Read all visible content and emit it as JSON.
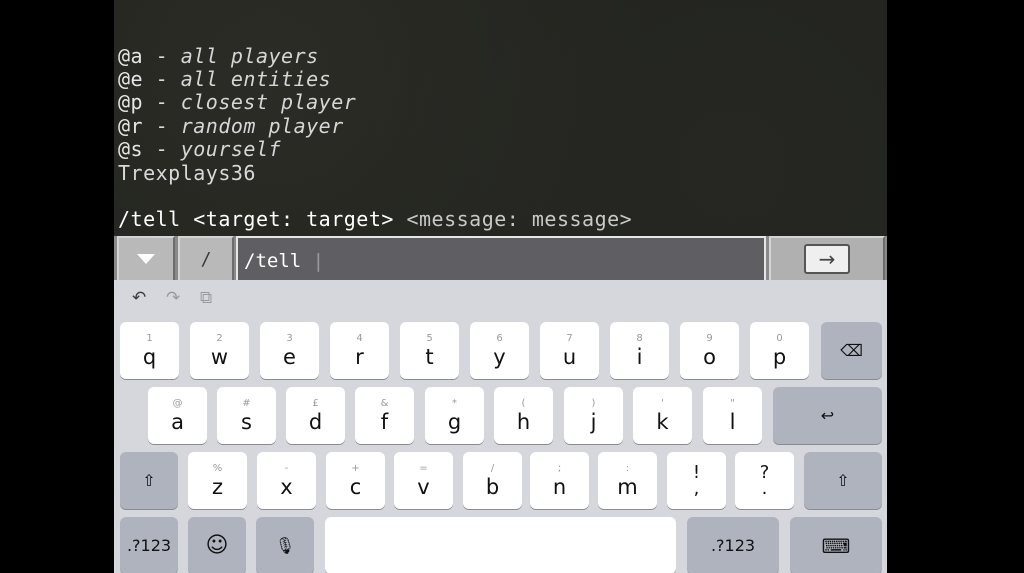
{
  "chat": {
    "hints": [
      {
        "selector": "@a",
        "sep": " - ",
        "desc": "all players"
      },
      {
        "selector": "@e",
        "sep": " - ",
        "desc": "all entities"
      },
      {
        "selector": "@p",
        "sep": " - ",
        "desc": "closest player"
      },
      {
        "selector": "@r",
        "sep": " - ",
        "desc": "random player"
      },
      {
        "selector": "@s",
        "sep": " - ",
        "desc": "yourself"
      }
    ],
    "player_name": "Trexplays36",
    "usage_cmd": "/tell ",
    "usage_params": "<target: target> <message: message>",
    "usage_params_cmd": "<target: target>",
    "usage_params_opt": " <message: message>"
  },
  "command_bar": {
    "slash_label": "/",
    "input_value": "/tell ",
    "caret": "|",
    "dropdown_icon": "triangle-down-icon",
    "enter_icon": "arrow-right-icon",
    "enter_glyph": "→"
  },
  "keyboard": {
    "toolbar": {
      "undo": "↶",
      "redo": "↷",
      "clipboard": "⧉"
    },
    "row1": [
      {
        "sub": "1",
        "main": "q"
      },
      {
        "sub": "2",
        "main": "w"
      },
      {
        "sub": "3",
        "main": "e"
      },
      {
        "sub": "4",
        "main": "r"
      },
      {
        "sub": "5",
        "main": "t"
      },
      {
        "sub": "6",
        "main": "y"
      },
      {
        "sub": "7",
        "main": "u"
      },
      {
        "sub": "8",
        "main": "i"
      },
      {
        "sub": "9",
        "main": "o"
      },
      {
        "sub": "0",
        "main": "p"
      }
    ],
    "row2": [
      {
        "sub": "@",
        "main": "a"
      },
      {
        "sub": "#",
        "main": "s"
      },
      {
        "sub": "£",
        "main": "d"
      },
      {
        "sub": "&",
        "main": "f"
      },
      {
        "sub": "*",
        "main": "g"
      },
      {
        "sub": "(",
        "main": "h"
      },
      {
        "sub": ")",
        "main": "j"
      },
      {
        "sub": "'",
        "main": "k"
      },
      {
        "sub": "\"",
        "main": "l"
      }
    ],
    "row3": [
      {
        "sub": "%",
        "main": "z"
      },
      {
        "sub": "-",
        "main": "x"
      },
      {
        "sub": "+",
        "main": "c"
      },
      {
        "sub": "=",
        "main": "v"
      },
      {
        "sub": "/",
        "main": "b"
      },
      {
        "sub": ";",
        "main": "n"
      },
      {
        "sub": ":",
        "main": "m"
      }
    ],
    "punct": [
      {
        "top": "!",
        "bottom": ","
      },
      {
        "top": "?",
        "bottom": "."
      }
    ],
    "backspace_glyph": "⌫",
    "return_glyph": "↩",
    "shift_glyph": "⇧",
    "numbers_label": ".?123",
    "numbers_label_left": ".?123",
    "emoji_glyph": "☺",
    "mic_glyph": "🎙",
    "hide_keyboard_glyph": "⌨"
  }
}
